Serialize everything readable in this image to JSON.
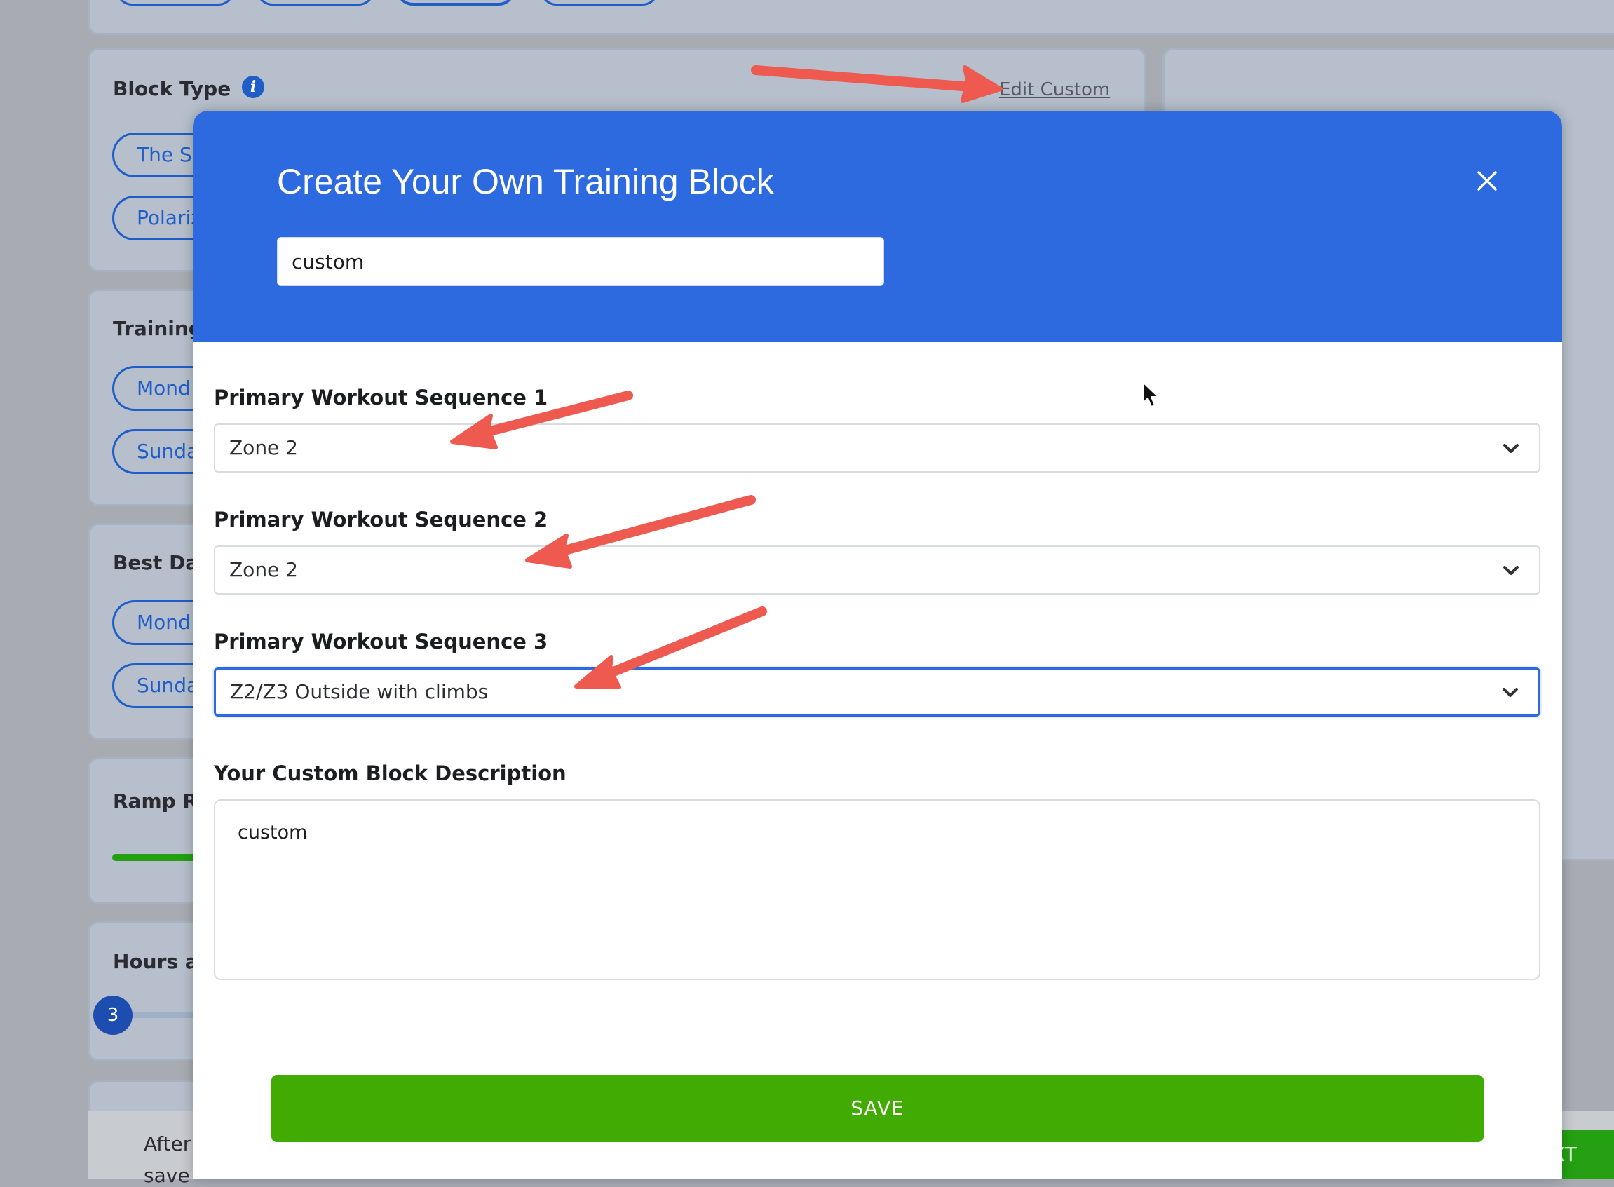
{
  "background": {
    "block_type": {
      "title": "Block Type",
      "edit_link": "Edit Custom",
      "pills": [
        "The Se",
        "Polariz"
      ]
    },
    "training": {
      "title": "Training",
      "pills": [
        "Mond",
        "Sunda"
      ]
    },
    "best_day": {
      "title": "Best Day",
      "pills": [
        "Mond",
        "Sunda"
      ]
    },
    "ramp": {
      "title": "Ramp Ra"
    },
    "hours": {
      "title": "Hours at",
      "value": "3"
    },
    "bottom_bar": {
      "line1": "After",
      "line2": "save",
      "next_label": "XT"
    }
  },
  "modal": {
    "title": "Create Your Own Training Block",
    "name_value": "custom",
    "fields": [
      {
        "label": "Primary Workout Sequence 1",
        "value": "Zone 2"
      },
      {
        "label": "Primary Workout Sequence 2",
        "value": "Zone 2"
      },
      {
        "label": "Primary Workout Sequence 3",
        "value": "Z2/Z3 Outside with climbs"
      }
    ],
    "description_label": "Your Custom Block Description",
    "description_value": "custom",
    "save_label": "SAVE"
  },
  "colors": {
    "header_blue": "#2d6ae0",
    "save_green": "#41aa03",
    "annotation_arrow": "#ee5a4f"
  },
  "icons": [
    "info-icon",
    "close-icon",
    "chevron-down-icon",
    "mouse-cursor-icon",
    "annotation-arrow"
  ]
}
